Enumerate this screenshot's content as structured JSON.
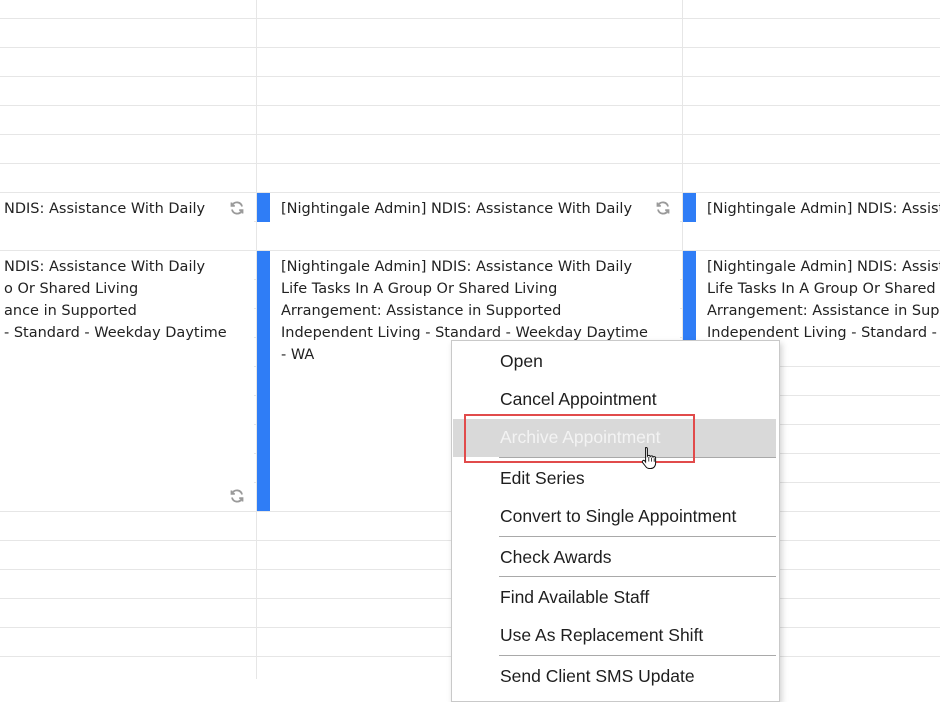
{
  "appointments": {
    "row1": {
      "left": "NDIS: Assistance With Daily",
      "middle": "[Nightingale Admin] NDIS: Assistance With Daily",
      "right": "[Nightingale Admin] NDIS: Assist"
    },
    "row2": {
      "left_lines": [
        "NDIS: Assistance With Daily",
        "o Or Shared Living",
        "ance in Supported",
        "- Standard - Weekday Daytime"
      ],
      "middle_lines": [
        "[Nightingale Admin] NDIS: Assistance With Daily",
        "Life Tasks In A Group Or Shared Living",
        "Arrangement: Assistance in Supported",
        "Independent Living - Standard - Weekday Daytime",
        "- WA"
      ],
      "right_lines": [
        "[Nightingale Admin] NDIS: Assist",
        "Life Tasks In A Group Or Shared L",
        "Arrangement: Assistance in Supp",
        "Independent Living - Standard - W"
      ]
    }
  },
  "context_menu": {
    "items": [
      {
        "label": "Open",
        "disabled": false
      },
      {
        "label": "Cancel Appointment",
        "disabled": false
      },
      {
        "label": "Archive Appointment",
        "disabled": true
      },
      {
        "label": "Edit Series",
        "disabled": false
      },
      {
        "label": "Convert to Single Appointment",
        "disabled": false
      },
      {
        "label": "Check Awards",
        "disabled": false
      },
      {
        "label": "Find Available Staff",
        "disabled": false
      },
      {
        "label": "Use As Replacement Shift",
        "disabled": false
      },
      {
        "label": "Send Client SMS Update",
        "disabled": false
      }
    ]
  },
  "colors": {
    "appointment_bar": "#2f7df6",
    "highlight_border": "#e14b4b",
    "disabled_item_bg": "#d9d9d9"
  },
  "icons": [
    "recurrence-icon",
    "hand-cursor-icon"
  ]
}
